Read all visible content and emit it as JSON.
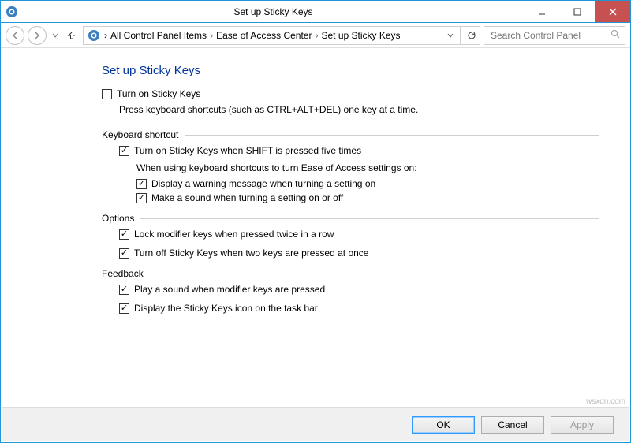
{
  "titlebar": {
    "title": "Set up Sticky Keys"
  },
  "breadcrumbs": {
    "items": [
      "All Control Panel Items",
      "Ease of Access Center",
      "Set up Sticky Keys"
    ]
  },
  "search": {
    "placeholder": "Search Control Panel"
  },
  "page": {
    "title": "Set up Sticky Keys",
    "turn_on_label": "Turn on Sticky Keys",
    "description": "Press keyboard shortcuts (such as CTRL+ALT+DEL) one key at a time."
  },
  "groups": {
    "shortcut": {
      "title": "Keyboard shortcut",
      "opt_shift5": "Turn on Sticky Keys when SHIFT is pressed five times",
      "subnote": "When using keyboard shortcuts to turn Ease of Access settings on:",
      "opt_warn": "Display a warning message when turning a setting on",
      "opt_sound": "Make a sound when turning a setting on or off"
    },
    "options": {
      "title": "Options",
      "opt_lock": "Lock modifier keys when pressed twice in a row",
      "opt_twokeys": "Turn off Sticky Keys when two keys are pressed at once"
    },
    "feedback": {
      "title": "Feedback",
      "opt_playsound": "Play a sound when modifier keys are pressed",
      "opt_taskbar": "Display the Sticky Keys icon on the task bar"
    }
  },
  "footer": {
    "ok": "OK",
    "cancel": "Cancel",
    "apply": "Apply"
  },
  "watermark": "wsxdn.com"
}
